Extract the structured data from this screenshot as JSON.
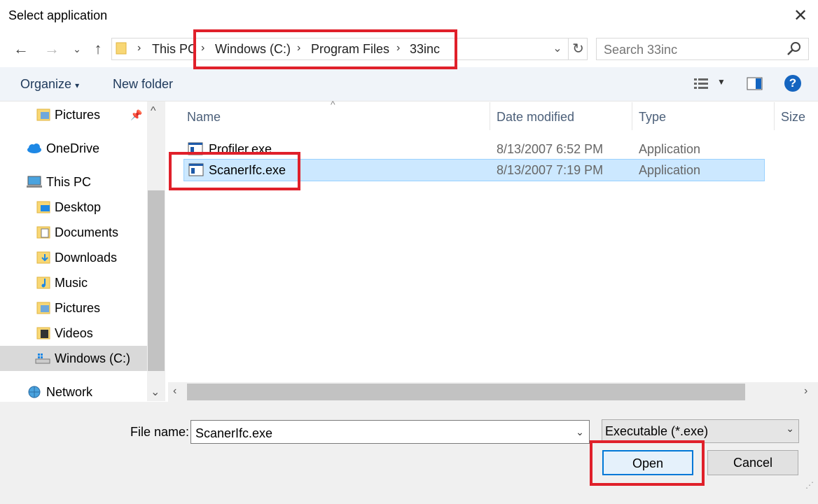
{
  "window": {
    "title": "Select application",
    "close_icon": "close-icon"
  },
  "address": {
    "crumbs": [
      "This PC",
      "Windows (C:)",
      "Program Files",
      "33inc"
    ],
    "search_placeholder": "Search 33inc"
  },
  "toolbar": {
    "organize": "Organize",
    "organize_arrow": "▾",
    "new_folder": "New folder",
    "help": "?"
  },
  "sidebar": {
    "items": [
      {
        "label": "Pictures",
        "icon": "pictures-folder-icon"
      },
      {
        "label": "OneDrive",
        "icon": "onedrive-icon"
      },
      {
        "label": "This PC",
        "icon": "computer-icon"
      },
      {
        "label": "Desktop",
        "icon": "desktop-folder-icon"
      },
      {
        "label": "Documents",
        "icon": "documents-folder-icon"
      },
      {
        "label": "Downloads",
        "icon": "downloads-folder-icon"
      },
      {
        "label": "Music",
        "icon": "music-folder-icon"
      },
      {
        "label": "Pictures",
        "icon": "pictures-folder-icon"
      },
      {
        "label": "Videos",
        "icon": "videos-folder-icon"
      },
      {
        "label": "Windows (C:)",
        "icon": "drive-icon",
        "selected": true
      },
      {
        "label": "Network",
        "icon": "network-icon"
      }
    ]
  },
  "columns": [
    "Name",
    "Date modified",
    "Type",
    "Size"
  ],
  "files": [
    {
      "name": "Profiler.exe",
      "date": "8/13/2007 6:52 PM",
      "type": "Application",
      "selected": false
    },
    {
      "name": "ScanerIfc.exe",
      "date": "8/13/2007 7:19 PM",
      "type": "Application",
      "selected": true
    }
  ],
  "bottom": {
    "file_name_label": "File name:",
    "file_name_value": "ScanerIfc.exe",
    "file_type": "Executable (*.exe)",
    "open_label": "Open",
    "cancel_label": "Cancel"
  },
  "colors": {
    "highlight": "#e0202a",
    "selection": "#cce8ff",
    "accent": "#0078d7"
  }
}
